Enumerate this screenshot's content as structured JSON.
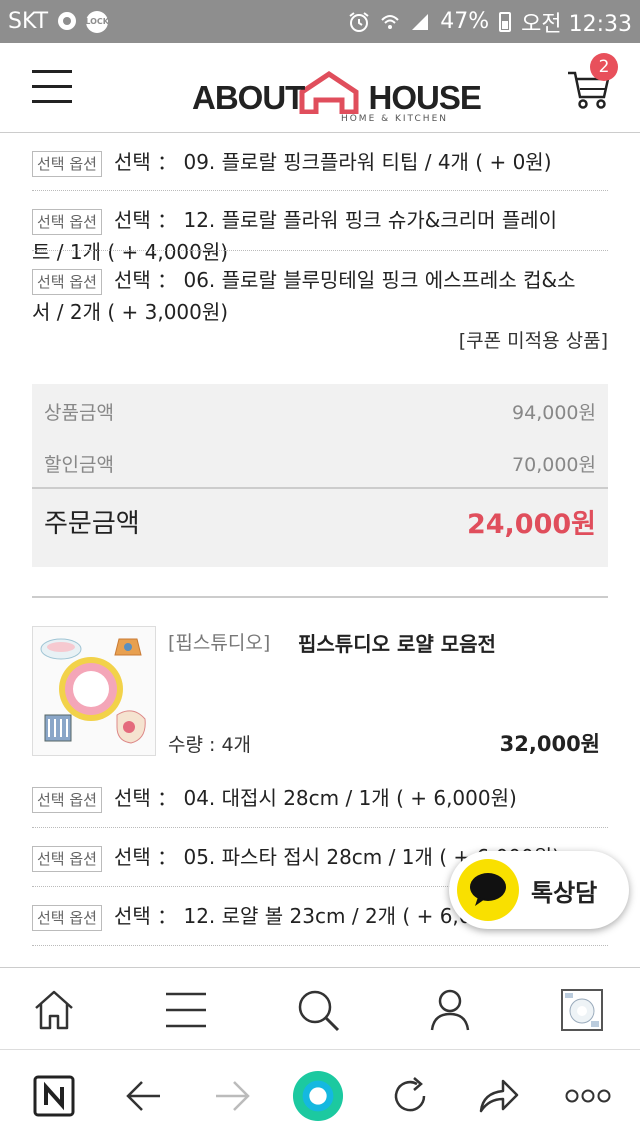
{
  "status_bar": {
    "carrier": "SKT",
    "battery": "47%",
    "time": "오전 12:33",
    "lock_label": "LOCK"
  },
  "header": {
    "logo_text": "ABOUT HOUSE",
    "logo_sub": "HOME & KITCHEN",
    "cart_count": "2"
  },
  "options_top": [
    {
      "tag": "선택 옵션",
      "text": "선택 ： 09. 플로랄 핑크플라워 티팁  /  4개  ( + 0원)"
    },
    {
      "tag": "선택 옵션",
      "text": "선택 ： 12. 플로랄 플라워 핑크 슈가&크리머 플레이",
      "wrap": "트  /  1개  ( + 4,000원)"
    },
    {
      "tag": "선택 옵션",
      "text": "선택 ： 06. 플로랄 블루밍테일 핑크 에스프레소 컵&소",
      "wrap": "서  /  2개  ( + 3,000원)"
    }
  ],
  "coupon_note": "[쿠폰 미적용 상품]",
  "summary": {
    "product_label": "상품금액",
    "product_value": "94,000원",
    "discount_label": "할인금액",
    "discount_value": "70,000원",
    "total_label": "주문금액",
    "total_value": "24,000원"
  },
  "product": {
    "brand": "[핍스튜디오]",
    "name": "핍스튜디오 로얄 모음전",
    "qty": "수량 : 4개",
    "price": "32,000원"
  },
  "options_bottom": [
    {
      "tag": "선택 옵션",
      "text": "선택 ： 04. 대접시 28cm  /  1개  ( + 6,000원)"
    },
    {
      "tag": "선택 옵션",
      "text": "선택 ： 05. 파스타 접시 28cm  /  1개  ( + 6,000원)"
    },
    {
      "tag": "선택 옵션",
      "text": "선택 ： 12. 로얄 볼 23cm  /  2개  ( + 6,000원)"
    }
  ],
  "kakao": {
    "label": "톡상담"
  },
  "bottom_nav": [
    "home-icon",
    "menu-icon",
    "search-icon",
    "user-icon",
    "recent-item-thumb"
  ],
  "browser_bar": [
    "naver-icon",
    "back-arrow-icon",
    "forward-arrow-icon",
    "home-circle-icon",
    "refresh-icon",
    "share-icon",
    "more-icon"
  ],
  "colors": {
    "accent_red": "#e04e5c",
    "kakao_yellow": "#f9e000",
    "status_gray": "#8e8e8e"
  }
}
